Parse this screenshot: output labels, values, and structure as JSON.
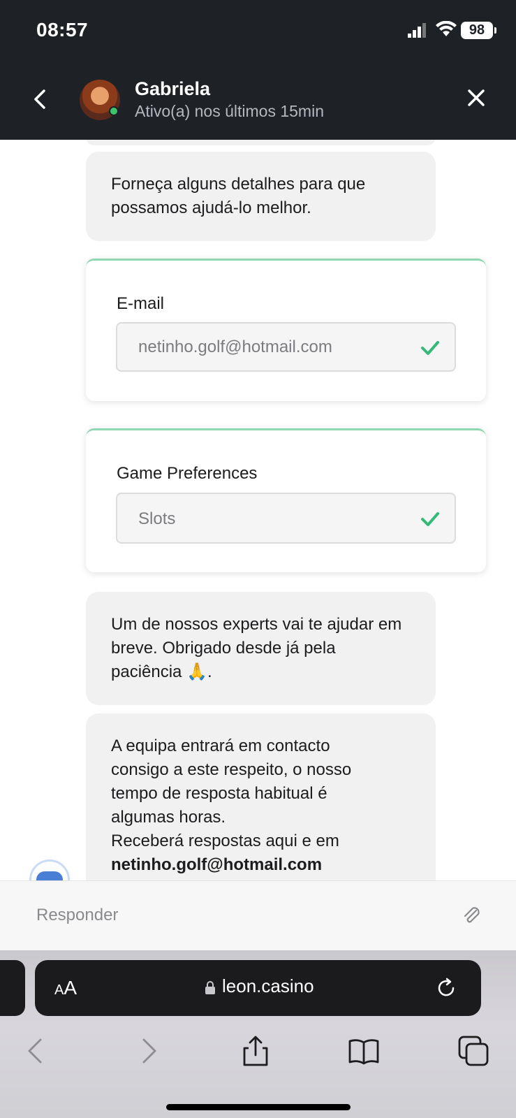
{
  "status_bar": {
    "time": "08:57",
    "battery": "98"
  },
  "header": {
    "agent_name": "Gabriela",
    "agent_status": "Ativo(a) nos últimos 15min"
  },
  "messages": {
    "prompt": "Forneça alguns detalhes para que possamos ajudá-lo melhor.",
    "expert_notice": "Um de nossos experts vai te ajudar em breve. Obrigado desde já pela paciência 🙏.",
    "team_notice_lines": [
      "A equipa entrará em contacto",
      "consigo a este respeito, o nosso",
      "tempo de resposta habitual é",
      "algumas horas.",
      "Receberá respostas aqui e em"
    ],
    "team_notice_email": "netinho.golf@hotmail.com"
  },
  "forms": {
    "email": {
      "label": "E-mail",
      "value": "netinho.golf@hotmail.com"
    },
    "game_preferences": {
      "label": "Game Preferences",
      "value": "Slots"
    }
  },
  "reply": {
    "placeholder": "Responder"
  },
  "browser": {
    "aa_label_small": "A",
    "aa_label_large": "A",
    "url": "leon.casino"
  },
  "colors": {
    "header_bg": "#1e2126",
    "accent_green": "#3ec46d",
    "check_green": "#34b97a"
  }
}
